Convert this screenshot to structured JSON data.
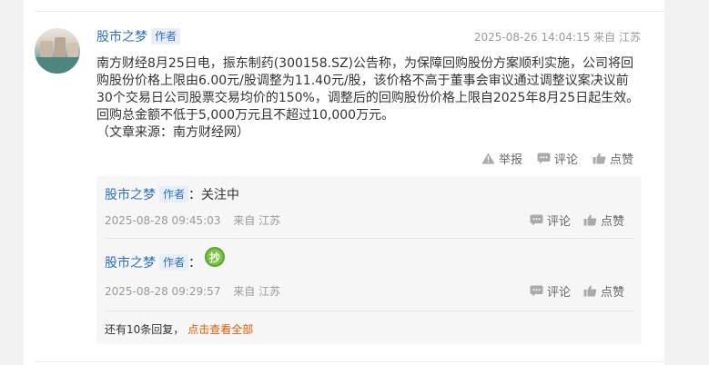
{
  "post": {
    "author": "股市之梦",
    "author_badge": "作者",
    "timestamp": "2025-08-26 14:04:15",
    "location": "来自 江苏",
    "content": "南方财经8月25日电，振东制药(300158.SZ)公告称，为保障回购股份方案顺利实施，公司将回购股份价格上限由6.00元/股调整为11.40元/股，该价格不高于董事会审议通过调整议案决议前30个交易日公司股票交易均价的150%，调整后的回购股份价格上限自2025年8月25日起生效。回购总金额不低于5,000万元且不超过10,000万元。",
    "source": "（文章来源：南方财经网）",
    "actions": {
      "report": "举报",
      "comment": "评论",
      "like": "点赞"
    }
  },
  "replies": [
    {
      "author": "股市之梦",
      "badge": "作者",
      "separator": "：",
      "text": "关注中",
      "timestamp": "2025-08-28 09:45:03",
      "location": "来自 江苏",
      "comment": "评论",
      "like": "点赞"
    },
    {
      "author": "股市之梦",
      "badge": "作者",
      "separator": "：",
      "emoji": "抄",
      "timestamp": "2025-08-28 09:29:57",
      "location": "来自 江苏",
      "comment": "评论",
      "like": "点赞"
    }
  ],
  "more": {
    "text": "还有10条回复，",
    "link": "点击查看全部"
  },
  "colors": {
    "link": "#2f6fc0",
    "more_link": "#e05a00",
    "badge_bg": "#e8eef7"
  }
}
